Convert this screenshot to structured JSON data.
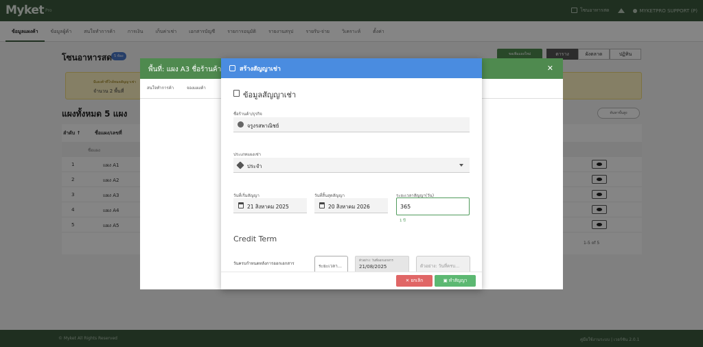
{
  "header": {
    "logo": "Myket",
    "logo_sub": "Pro",
    "shop_label": "โซนอาหารสด",
    "user_label": "MYKETPRO SUPPORT (P)"
  },
  "nav": {
    "items": [
      {
        "label": "ข้อมูลแผงค้า",
        "active": true
      },
      {
        "label": "ข้อมูลผู้ค้า"
      },
      {
        "label": "สนใจทำการค้า"
      },
      {
        "label": "การเงิน"
      },
      {
        "label": "เก็บค่าเช่า"
      },
      {
        "label": "เอกสารบัญชี"
      },
      {
        "label": "รายการอนุมัติ"
      },
      {
        "label": "รายงานสรุป"
      },
      {
        "label": "รายรับ-จ่าย"
      },
      {
        "label": "วิเคราะห์"
      },
      {
        "label": "ตั้งค่า"
      }
    ]
  },
  "page": {
    "title": "โซนอาหารสด",
    "badge": "5 ห้อง",
    "primary_button": "ขอเพิ่มแผงใหม่",
    "view_options": [
      "ตาราง",
      "ผังตลาด",
      "ปฏิทิน"
    ],
    "notice_line1": "มีแผงค้าที่ใกล้หมดสัญญาเช่า",
    "notice_line2": "จำนวน 2 พื้นที่",
    "count_title": "แผงทั้งหมด 5 แผง",
    "filter_button": "ค้นหาขั้นสูง",
    "table": {
      "headers": [
        "ลำดับ ↑",
        "ชื่อแผง/เลขที่"
      ],
      "filter_placeholder": "ชื่อแผง",
      "rows": [
        {
          "no": "1",
          "name": "แผง A1"
        },
        {
          "no": "2",
          "name": "แผง A2"
        },
        {
          "no": "3",
          "name": "แผง A3"
        },
        {
          "no": "4",
          "name": "แผง A4"
        },
        {
          "no": "5",
          "name": "แผง A5"
        }
      ],
      "pagination": "1-5 of 5"
    }
  },
  "dialog_back": {
    "title": "พื้นที่: แผง A3  ชื่อร้านค้า",
    "tabs": [
      "สนใจทำการค้า",
      "จองแผงค้า"
    ]
  },
  "dialog": {
    "title": "สร้างสัญญาเช่า",
    "section_title": "ข้อมูลสัญญาเช่า",
    "business_label": "ชื่อร้านค้า/ธุรกิจ",
    "business_value": "จรูงรสพาณิชย์",
    "stall_type_label": "ประเภทแผงเช่า",
    "stall_type_value": "ประจำ",
    "start_label": "วันที่เริ่มสัญญา",
    "start_value": "21 สิงหาคม 2025",
    "end_label": "วันที่สิ้นสุดสัญญา",
    "end_value": "20 สิงหาคม 2026",
    "duration_label": "ระยะเวลาสัญญา(วัน)",
    "duration_value": "365",
    "duration_hint": "1 ปี",
    "credit_title": "Credit Term",
    "credit_label": "วันครบกำหนดหลังการออกเอกสาร",
    "credit_period_placeholder": "ระยะเวลา...",
    "credit_example_label": "ตัวอย่าง: วันที่ออกเอกสาร",
    "credit_example_value": "21/08/2025",
    "credit_due_placeholder": "ตัวอย่าง: วันที่ครบ...",
    "cancel_label": "ยกเลิก",
    "confirm_label": "ทำสัญญา"
  },
  "footer": {
    "copyright": "© Myket All Rights Reserved",
    "version": "คู่มือใช้งานระบบ | เวอร์ชัน 2.0.1"
  },
  "colors": {
    "brand_green": "#3d5a3f",
    "dialog_blue": "#4a8ce0",
    "confirm_green": "#5cb872",
    "cancel_red": "#e06666"
  }
}
